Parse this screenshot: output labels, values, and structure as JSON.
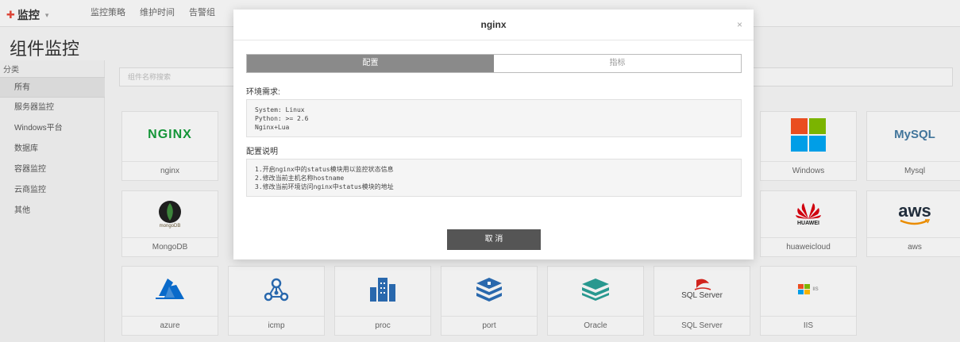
{
  "topbar": {
    "app_title": "监控",
    "nav": [
      "监控策略",
      "维护时间",
      "告警组"
    ]
  },
  "page": {
    "title": "组件监控",
    "category_label": "分类",
    "search_placeholder": "组件名称搜索"
  },
  "sidebar": {
    "items": [
      {
        "label": "所有",
        "active": true
      },
      {
        "label": "服务器监控"
      },
      {
        "label": "Windows平台"
      },
      {
        "label": "数据库"
      },
      {
        "label": "容器监控"
      },
      {
        "label": "云商监控"
      },
      {
        "label": "其他"
      }
    ]
  },
  "components": [
    {
      "name": "nginx",
      "icon": "nginx-logo"
    },
    {
      "name": "Windows",
      "icon": "windows-logo"
    },
    {
      "name": "Mysql",
      "icon": "mysql-logo"
    },
    {
      "name": "MongoDB",
      "icon": "mongodb-logo",
      "icon_text": "mongoDB"
    },
    {
      "name": "huaweicloud",
      "icon": "huawei-logo"
    },
    {
      "name": "aws",
      "icon": "aws-logo"
    },
    {
      "name": "azure",
      "icon": "azure-logo"
    },
    {
      "name": "icmp",
      "icon": "network-nodes-icon"
    },
    {
      "name": "proc",
      "icon": "buildings-icon"
    },
    {
      "name": "port",
      "icon": "stack-cube-icon"
    },
    {
      "name": "Oracle",
      "icon": "layers-icon"
    },
    {
      "name": "SQL Server",
      "icon": "sqlserver-logo"
    },
    {
      "name": "IIS",
      "icon": "iis-logo"
    }
  ],
  "logo_text": {
    "nginx": "NGINX",
    "mysql": "MySQL",
    "aws": "aws",
    "huawei": "HUAWEI",
    "sqlserver": "SQL Server",
    "iis": "IIS"
  },
  "modal": {
    "title": "nginx",
    "close": "×",
    "tabs": [
      {
        "label": "配置",
        "active": true
      },
      {
        "label": "指标"
      }
    ],
    "env_label": "环境需求:",
    "env_lines": [
      "System: Linux",
      "Python: >= 2.6",
      "Nginx+Lua"
    ],
    "config_label": "配置说明",
    "config_lines": [
      "1.开启nginx中的status模块用以监控状态信息",
      "2.修改当前主机名称hostname",
      "3.修改当前环境访问nginx中status模块的地址"
    ],
    "cancel_label": "取 消"
  },
  "colors": {
    "brand_red": "#e4493a",
    "cancel_button": "#555555",
    "active_tab": "#8a8a8a",
    "azure_blue": "#0a6ed1",
    "icon_blue": "#2b6cb3",
    "oracle_teal": "#2a9d94",
    "aws_orange": "#f29100",
    "huawei_red": "#d7000f",
    "mongodb_green": "#3f8a3d"
  }
}
